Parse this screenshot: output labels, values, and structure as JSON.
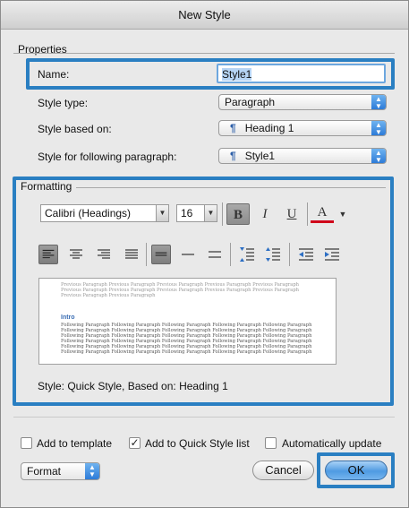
{
  "window": {
    "title": "New Style"
  },
  "properties": {
    "group_label": "Properties",
    "name_label": "Name:",
    "name_value": "Style1",
    "style_type_label": "Style type:",
    "style_type_value": "Paragraph",
    "based_on_label": "Style based on:",
    "based_on_value": "Heading 1",
    "following_label": "Style for following paragraph:",
    "following_value": "Style1"
  },
  "formatting": {
    "group_label": "Formatting",
    "font_name": "Calibri (Headings)",
    "font_size": "16",
    "bold_label": "B",
    "italic_label": "I",
    "underline_label": "U",
    "font_color_label": "A",
    "font_color": "#d0021b",
    "preview": {
      "previous_text": "Previous Paragraph Previous Paragraph Previous Paragraph Previous Paragraph Previous Paragraph Previous Paragraph Previous Paragraph Previous Paragraph Previous Paragraph Previous Paragraph Previous Paragraph Previous Paragraph",
      "heading_text": "Intro",
      "following_text": "Following Paragraph Following Paragraph Following Paragraph Following Paragraph Following Paragraph Following Paragraph Following Paragraph Following Paragraph Following Paragraph Following Paragraph Following Paragraph Following Paragraph Following Paragraph Following Paragraph Following Paragraph Following Paragraph Following Paragraph Following Paragraph Following Paragraph Following Paragraph Following Paragraph Following Paragraph Following Paragraph Following Paragraph Following Paragraph Following Paragraph Following Paragraph Following Paragraph Following Paragraph Following Paragraph"
    },
    "description": "Style: Quick Style, Based on: Heading 1"
  },
  "options": {
    "add_to_template_label": "Add to template",
    "add_to_template_checked": false,
    "add_to_quick_style_label": "Add to Quick Style list",
    "add_to_quick_style_checked": true,
    "auto_update_label": "Automatically update",
    "auto_update_checked": false
  },
  "footer": {
    "format_menu_label": "Format",
    "cancel_label": "Cancel",
    "ok_label": "OK"
  },
  "colors": {
    "highlight": "#2a7fc2",
    "accent": "#4f9be2"
  }
}
